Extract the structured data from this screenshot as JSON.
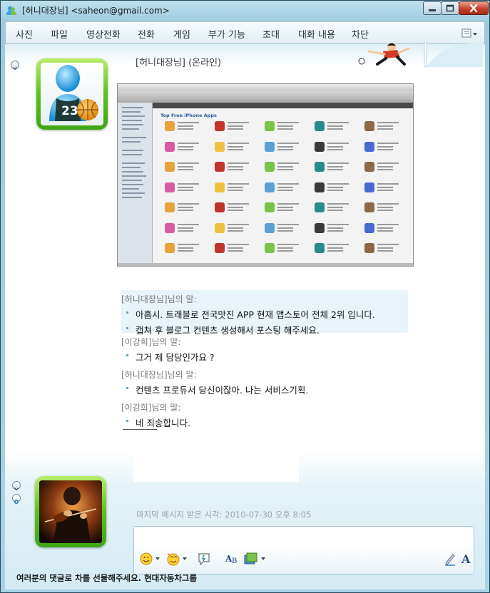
{
  "window": {
    "title": "[허니대장님] <saheon@gmail.com>"
  },
  "menu": [
    "사진",
    "파일",
    "영상전화",
    "전화",
    "게임",
    "부가 기능",
    "초대",
    "대화 내용",
    "차단"
  ],
  "contact": {
    "name": "[허니대장님] (온라인)",
    "avatar_jersey": "23"
  },
  "screenshot": {
    "heading": "Top Free iPhone Apps"
  },
  "messages": [
    {
      "sender": "[허니대장님]님의 말:",
      "lines": [
        "아홉시. 트래블로 전국맛진 APP 현재 앱스토어 전체 2위 입니다.",
        "캡쳐 후 블로그 컨텐츠 생성해서 포스팅 해주세요."
      ]
    },
    {
      "sender": "[이강희]님의 말:",
      "lines": [
        "그거 제 담당인가요 ?"
      ]
    },
    {
      "sender": "[허니대장님]님의 말:",
      "lines": [
        "컨텐츠 프로듀서 당신이잖아. 나는 서비스기획."
      ]
    },
    {
      "sender": "[이강희]님의 말:",
      "lines": [
        "네 죄송합니다."
      ]
    }
  ],
  "status": {
    "last_received": "마지막 메시지 받은 시각: 2010-07-30 오후 8:05"
  },
  "input": {
    "value": ""
  },
  "ad": {
    "text": "여러분의 댓글로 차를 선물해주세요. 현대자동차그룹"
  },
  "colors": {
    "accent": "#6aa2c0",
    "avatar_frame": "#58c21e",
    "close_button": "#c6402a"
  }
}
